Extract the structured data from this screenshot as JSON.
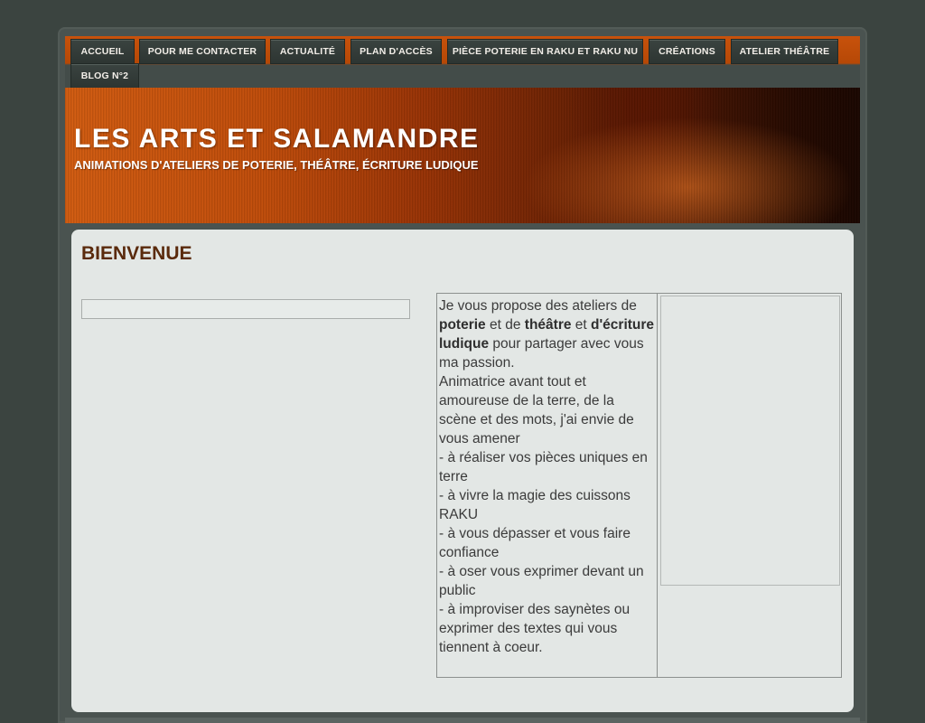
{
  "nav": {
    "items": [
      {
        "label": "ACCUEIL"
      },
      {
        "label": "POUR ME CONTACTER"
      },
      {
        "label": "ACTUALITÉ"
      },
      {
        "label": "PLAN D'ACCÈS"
      },
      {
        "label": "PIÈCE POTERIE EN RAKU ET RAKU NU"
      },
      {
        "label": "CRÉATIONS"
      },
      {
        "label": "ATELIER THÉÂTRE"
      },
      {
        "label": "BLOG N°2"
      }
    ]
  },
  "header": {
    "title": "LES ARTS ET SALAMANDRE",
    "subtitle": "ANIMATIONS D'ATELIERS DE POTERIE, THÉÂTRE, ÉCRITURE LUDIQUE"
  },
  "main": {
    "title": "BIENVENUE",
    "intro": {
      "t1": "Je vous propose des ateliers de ",
      "b1": "poterie",
      "t2": " et de ",
      "b2": "théâtre",
      "t3": " et ",
      "b3": "d'écriture ludique",
      "t4": " pour partager avec vous ma passion."
    },
    "paragraph": "Animatrice avant tout et amoureuse de la terre, de la scène et des mots, j'ai envie de vous amener",
    "list": [
      "- à réaliser vos pièces uniques en terre",
      "- à vivre la magie des cuissons RAKU",
      "- à vous dépasser et vous faire confiance",
      "- à oser vous exprimer devant un public",
      "- à improviser des saynètes ou exprimer des textes qui vous tiennent à coeur."
    ]
  },
  "colors": {
    "nav_bar": "#c8520c",
    "title_brown": "#5a2a0c",
    "content_bg": "#e3e7e5"
  }
}
